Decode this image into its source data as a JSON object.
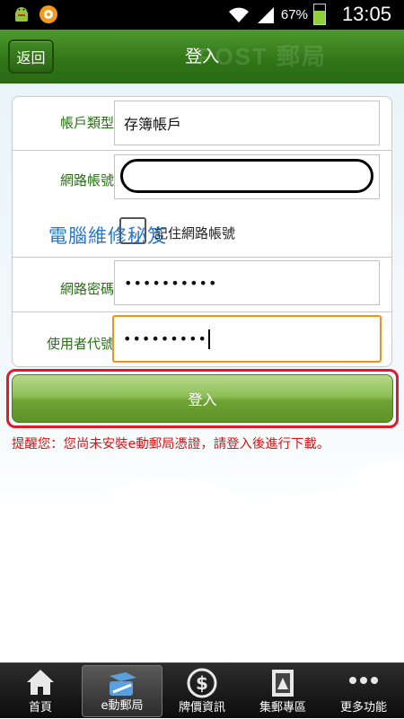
{
  "status_bar": {
    "battery_pct": "67%",
    "time": "13:05",
    "icons": [
      "android-debug-icon",
      "notification-icon",
      "wifi-icon",
      "signal-icon",
      "battery-icon"
    ]
  },
  "header": {
    "back_label": "返回",
    "title": "登入",
    "watermark": "POST 郵局"
  },
  "form": {
    "account_type": {
      "label": "帳戶類型",
      "value": "存簿帳戶"
    },
    "web_account": {
      "label": "網路帳號",
      "value": ""
    },
    "remember": {
      "label": "記住網路帳號",
      "checked": false
    },
    "web_password": {
      "label": "網路密碼",
      "value": "••••••••••"
    },
    "user_code": {
      "label": "使用者代號",
      "value": "•••••••••"
    },
    "blog_watermark": "電腦維修秘笈"
  },
  "login_button": "登入",
  "reminder": "提醒您：您尚未安裝e動郵局憑證，請登入後進行下載。",
  "bottom_nav": {
    "items": [
      {
        "label": "首頁",
        "icon": "home-icon"
      },
      {
        "label": "e動郵局",
        "icon": "e-post-icon"
      },
      {
        "label": "牌價資訊",
        "icon": "dollar-icon"
      },
      {
        "label": "集郵專區",
        "icon": "stamp-icon"
      },
      {
        "label": "更多功能",
        "icon": "more-icon"
      }
    ],
    "active_index": 1
  },
  "colors": {
    "header_green": "#2f7417",
    "label_green": "#2b6e1a",
    "focus_orange": "#f1931b",
    "highlight_red": "#e01a2c",
    "reminder_red": "#d61414"
  }
}
